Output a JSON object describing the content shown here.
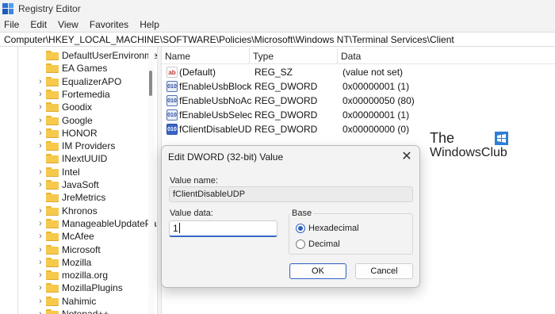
{
  "window": {
    "title": "Registry Editor"
  },
  "menu": [
    "File",
    "Edit",
    "View",
    "Favorites",
    "Help"
  ],
  "address": "Computer\\HKEY_LOCAL_MACHINE\\SOFTWARE\\Policies\\Microsoft\\Windows NT\\Terminal Services\\Client",
  "tree": [
    {
      "label": "DefaultUserEnvironme",
      "expandable": false
    },
    {
      "label": "EA Games",
      "expandable": false
    },
    {
      "label": "EqualizerAPO",
      "expandable": true
    },
    {
      "label": "Fortemedia",
      "expandable": true
    },
    {
      "label": "Goodix",
      "expandable": true
    },
    {
      "label": "Google",
      "expandable": true
    },
    {
      "label": "HONOR",
      "expandable": true
    },
    {
      "label": "IM Providers",
      "expandable": true
    },
    {
      "label": "INextUUID",
      "expandable": false
    },
    {
      "label": "Intel",
      "expandable": true
    },
    {
      "label": "JavaSoft",
      "expandable": true
    },
    {
      "label": "JreMetrics",
      "expandable": false
    },
    {
      "label": "Khronos",
      "expandable": true
    },
    {
      "label": "ManageableUpdatePa",
      "expandable": true
    },
    {
      "label": "McAfee",
      "expandable": true
    },
    {
      "label": "Microsoft",
      "expandable": true
    },
    {
      "label": "Mozilla",
      "expandable": true
    },
    {
      "label": "mozilla.org",
      "expandable": true
    },
    {
      "label": "MozillaPlugins",
      "expandable": true
    },
    {
      "label": "Nahimic",
      "expandable": true
    },
    {
      "label": "Notepad++",
      "expandable": true
    }
  ],
  "columns": {
    "name": "Name",
    "type": "Type",
    "data": "Data"
  },
  "values": [
    {
      "icon": "string-value-icon",
      "badge": "ab",
      "name": "(Default)",
      "type": "REG_SZ",
      "data": "(value not set)"
    },
    {
      "icon": "dword-value-icon",
      "badge": "010",
      "name": "fEnableUsbBlock...",
      "type": "REG_DWORD",
      "data": "0x00000001 (1)"
    },
    {
      "icon": "dword-value-icon",
      "badge": "010",
      "name": "fEnableUsbNoAc...",
      "type": "REG_DWORD",
      "data": "0x00000050 (80)"
    },
    {
      "icon": "dword-value-icon",
      "badge": "010",
      "name": "fEnableUsbSelec...",
      "type": "REG_DWORD",
      "data": "0x00000001 (1)"
    },
    {
      "icon": "dword-value-icon",
      "badge": "010",
      "name": "fClientDisableUDP",
      "type": "REG_DWORD",
      "data": "0x00000000 (0)"
    }
  ],
  "watermark": {
    "line1": "The",
    "line2": "WindowsClub"
  },
  "dialog": {
    "title": "Edit DWORD (32-bit) Value",
    "close": "✕",
    "value_name_label": "Value name:",
    "value_name": "fClientDisableUDP",
    "value_data_label": "Value data:",
    "value_data": "1",
    "base_label": "Base",
    "radio_hex": "Hexadecimal",
    "radio_dec": "Decimal",
    "selected_base": "Hexadecimal",
    "ok": "OK",
    "cancel": "Cancel"
  },
  "colors": {
    "accent": "#3a66c4",
    "folder": "#f6c94c",
    "chrome": "#f3f3f3"
  }
}
